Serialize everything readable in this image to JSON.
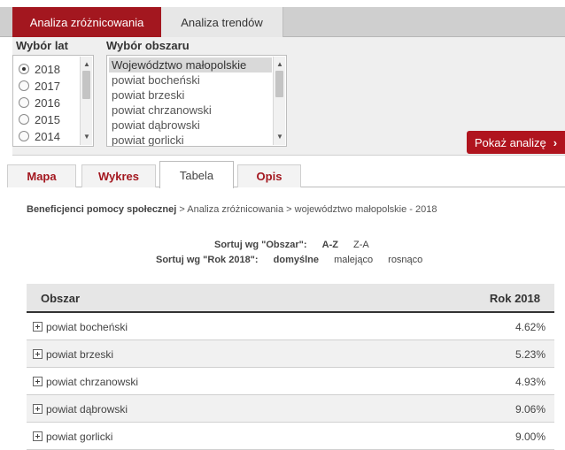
{
  "top_tabs": [
    {
      "label": "Analiza zróżnicowania",
      "active": true
    },
    {
      "label": "Analiza trendów",
      "active": false
    }
  ],
  "filters": {
    "years_title": "Wybór lat",
    "years": [
      "2018",
      "2017",
      "2016",
      "2015",
      "2014"
    ],
    "selected_year": "2018",
    "area_title": "Wybór obszaru",
    "areas": [
      "Województwo małopolskie",
      "powiat bocheński",
      "powiat brzeski",
      "powiat chrzanowski",
      "powiat dąbrowski",
      "powiat gorlicki"
    ],
    "selected_area": "Województwo małopolskie"
  },
  "show_button": {
    "label": "Pokaż analizę",
    "icon": "chevron-right-icon"
  },
  "sub_tabs": [
    {
      "label": "Mapa",
      "active": false
    },
    {
      "label": "Wykres",
      "active": false
    },
    {
      "label": "Tabela",
      "active": true
    },
    {
      "label": "Opis",
      "active": false
    }
  ],
  "breadcrumb": {
    "first": "Beneficjenci pomocy społecznej",
    "rest": " > Analiza zróżnicowania > województwo małopolskie - 2018"
  },
  "sort": {
    "area_label": "Sortuj wg \"Obszar\":",
    "area_options": [
      "A-Z",
      "Z-A"
    ],
    "year_label": "Sortuj wg \"Rok 2018\":",
    "year_options": [
      "domyślne",
      "malejąco",
      "rosnąco"
    ]
  },
  "table": {
    "columns": [
      "Obszar",
      "Rok 2018"
    ],
    "rows": [
      {
        "area": "powiat bocheński",
        "value": "4.62%"
      },
      {
        "area": "powiat brzeski",
        "value": "5.23%"
      },
      {
        "area": "powiat chrzanowski",
        "value": "4.93%"
      },
      {
        "area": "powiat dąbrowski",
        "value": "9.06%"
      },
      {
        "area": "powiat gorlicki",
        "value": "9.00%"
      }
    ]
  },
  "colors": {
    "accent": "#a3171f",
    "header_bg": "#cfcfcf",
    "panel_bg": "#efefef"
  }
}
